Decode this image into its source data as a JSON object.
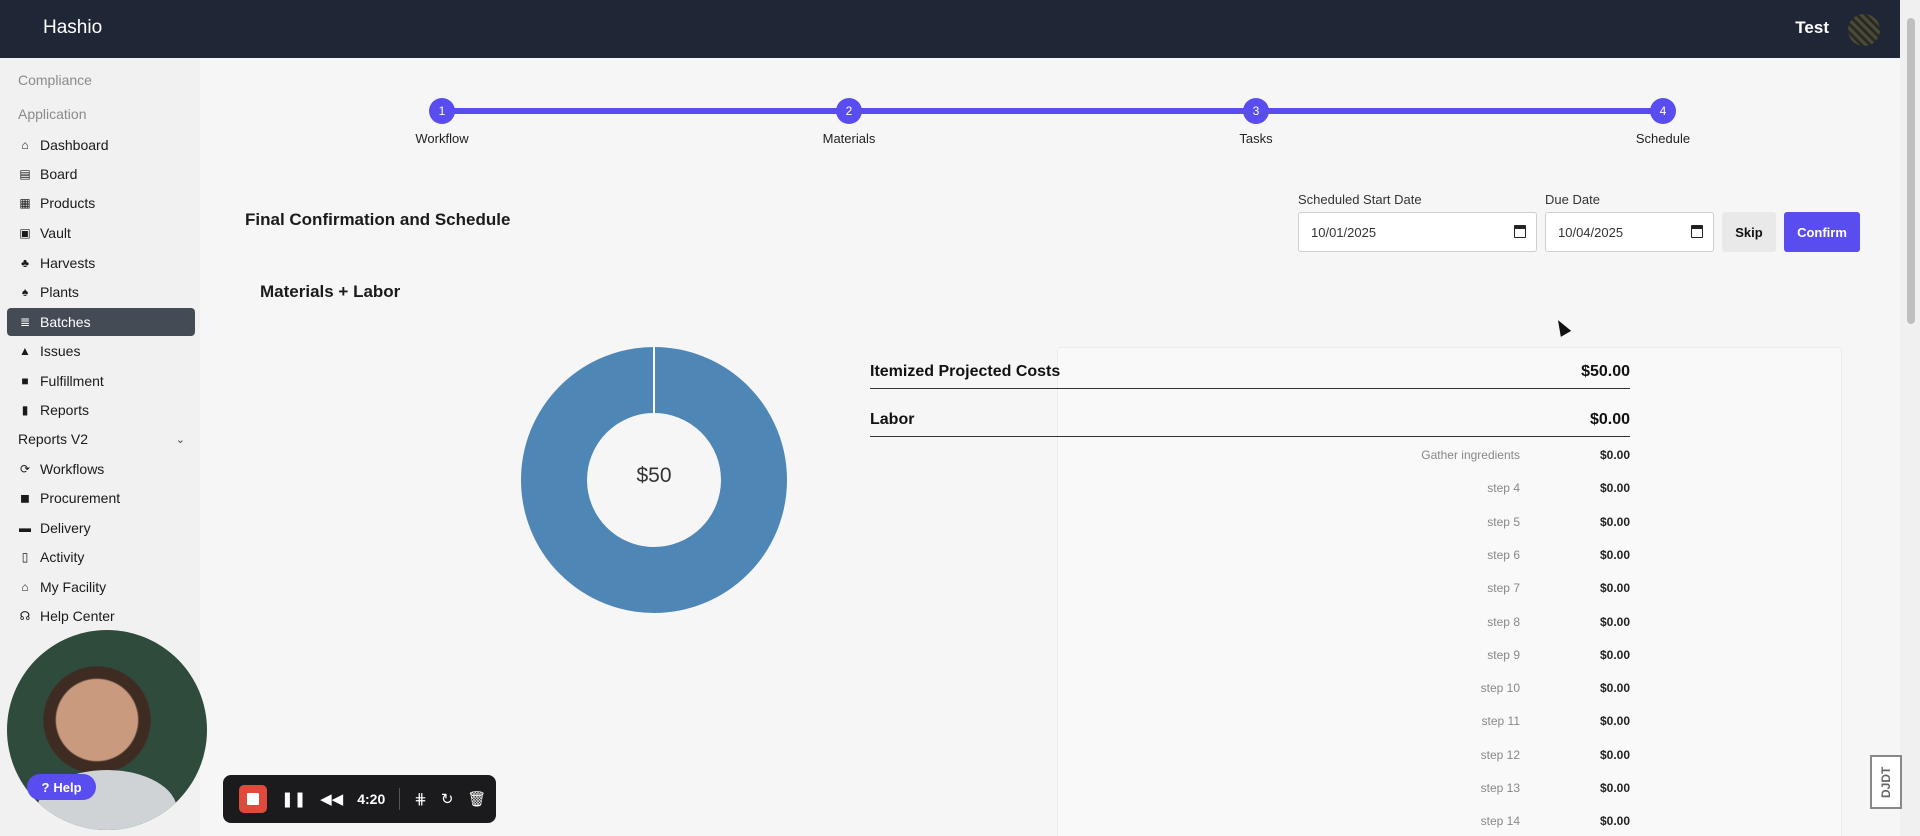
{
  "app": {
    "title": "Hashio",
    "user": "Test"
  },
  "sidebar": {
    "sections": [
      "Compliance",
      "Application"
    ],
    "items": [
      {
        "label": "Dashboard",
        "icon": "home-icon"
      },
      {
        "label": "Board",
        "icon": "board-icon"
      },
      {
        "label": "Products",
        "icon": "products-icon"
      },
      {
        "label": "Vault",
        "icon": "vault-icon"
      },
      {
        "label": "Harvests",
        "icon": "harvest-icon"
      },
      {
        "label": "Plants",
        "icon": "plant-icon"
      },
      {
        "label": "Batches",
        "icon": "batches-icon",
        "active": true
      },
      {
        "label": "Issues",
        "icon": "warning-icon"
      },
      {
        "label": "Fulfillment",
        "icon": "box-icon"
      },
      {
        "label": "Reports",
        "icon": "chart-icon"
      },
      {
        "label": "Reports V2",
        "icon": "chevron-down-icon"
      },
      {
        "label": "Workflows",
        "icon": "workflow-icon"
      },
      {
        "label": "Procurement",
        "icon": "bag-icon"
      },
      {
        "label": "Delivery",
        "icon": "truck-icon"
      },
      {
        "label": "Activity",
        "icon": "clipboard-icon"
      },
      {
        "label": "My Facility",
        "icon": "building-icon"
      },
      {
        "label": "Help Center",
        "icon": "headset-icon"
      }
    ]
  },
  "stepper": [
    {
      "num": "1",
      "label": "Workflow"
    },
    {
      "num": "2",
      "label": "Materials"
    },
    {
      "num": "3",
      "label": "Tasks"
    },
    {
      "num": "4",
      "label": "Schedule"
    }
  ],
  "main": {
    "title": "Final Confirmation and Schedule",
    "subtitle": "Materials + Labor",
    "start_label": "Scheduled Start Date",
    "start_value": "10/01/2025",
    "due_label": "Due Date",
    "due_value": "10/04/2025",
    "skip": "Skip",
    "confirm": "Confirm"
  },
  "chart_data": {
    "type": "pie",
    "center_label": "$50",
    "slices": [
      {
        "value": 50
      }
    ],
    "colors": [
      "#4e86b6"
    ]
  },
  "costs": {
    "header_label": "Itemized Projected Costs",
    "header_value": "$50.00",
    "labor_label": "Labor",
    "labor_value": "$0.00",
    "rows": [
      {
        "name": "Gather ingredients",
        "value": "$0.00"
      },
      {
        "name": "step 4",
        "value": "$0.00"
      },
      {
        "name": "step 5",
        "value": "$0.00"
      },
      {
        "name": "step 6",
        "value": "$0.00"
      },
      {
        "name": "step 7",
        "value": "$0.00"
      },
      {
        "name": "step 8",
        "value": "$0.00"
      },
      {
        "name": "step 9",
        "value": "$0.00"
      },
      {
        "name": "step 10",
        "value": "$0.00"
      },
      {
        "name": "step 11",
        "value": "$0.00"
      },
      {
        "name": "step 12",
        "value": "$0.00"
      },
      {
        "name": "step 13",
        "value": "$0.00"
      },
      {
        "name": "step 14",
        "value": "$0.00"
      }
    ]
  },
  "overlay": {
    "help": "Help",
    "timer": "4:20",
    "badge": "DJDT"
  },
  "colors": {
    "accent": "#5a4df0",
    "topbar": "#1f2737",
    "donut": "#4e86b6"
  }
}
